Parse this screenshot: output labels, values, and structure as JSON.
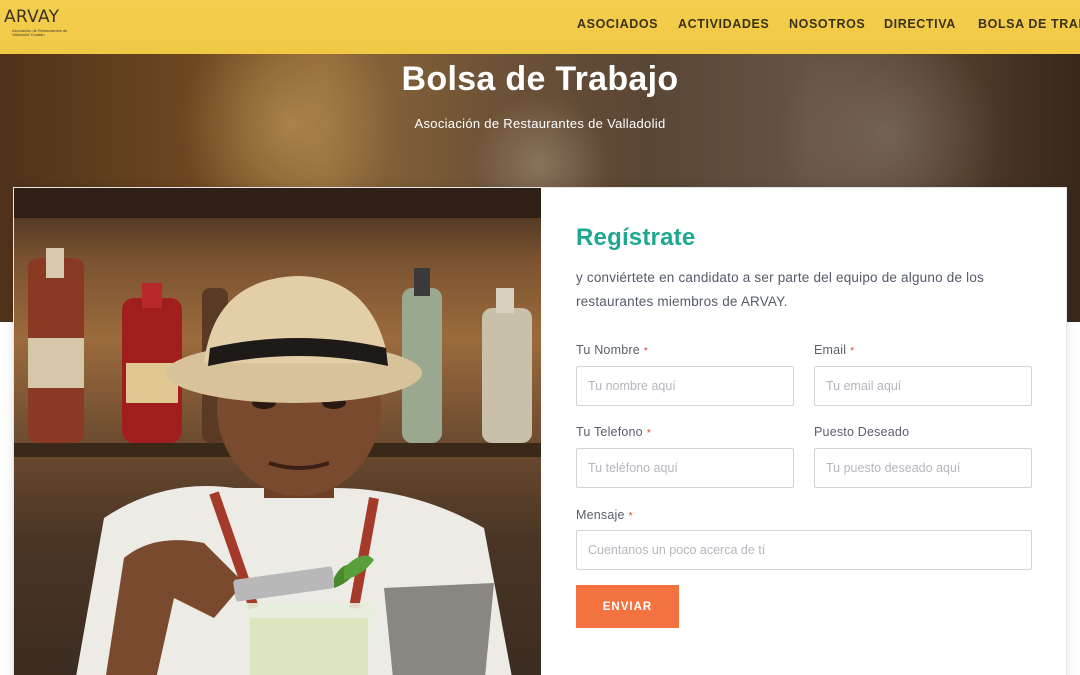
{
  "header": {
    "logo_text": "ARVAY",
    "logo_subtext": "Asociación de Restaurantes de Valladolid Yucatán",
    "nav": [
      "ASOCIADOS",
      "ACTIVIDADES",
      "NOSOTROS",
      "DIRECTIVA",
      "BOLSA DE TRAB"
    ]
  },
  "hero": {
    "title": "Bolsa de Trabajo",
    "subtitle": "Asociación de Restaurantes de Valladolid"
  },
  "form": {
    "title": "Regístrate",
    "description": "y conviértete en candidato a ser parte del equipo de alguno de los restaurantes miembros de ARVAY.",
    "required_mark": "*",
    "fields": {
      "name": {
        "label": "Tu Nombre",
        "placeholder": "Tu nombre aquí"
      },
      "email": {
        "label": "Email",
        "placeholder": "Tu email aquí"
      },
      "phone": {
        "label": "Tu Telefono",
        "placeholder": "Tu teléfono aquí"
      },
      "position": {
        "label": "Puesto Deseado",
        "placeholder": "Tu puesto deseado aquí"
      },
      "message": {
        "label": "Mensaje",
        "placeholder": "Cuentanos un poco acerca de tí"
      }
    },
    "submit_label": "ENVIAR"
  },
  "colors": {
    "header_bg": "#f2c94c",
    "title_accent": "#1ea88f",
    "button": "#f47240",
    "required": "#e53935"
  }
}
